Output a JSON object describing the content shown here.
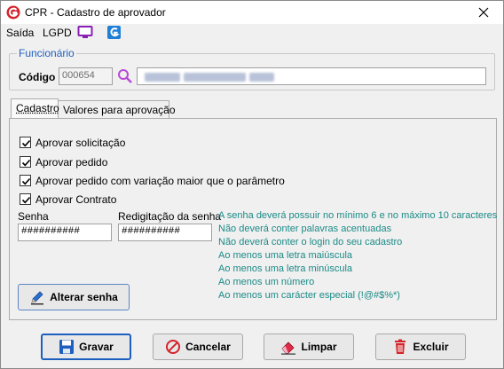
{
  "window": {
    "title": "CPR - Cadastro de aprovador"
  },
  "menu": {
    "items": [
      {
        "label": "Saída"
      },
      {
        "label": "LGPD"
      }
    ]
  },
  "funcionario": {
    "group_title": "Funcionário",
    "codigo_label": "Código",
    "codigo_value": "000654",
    "name_value_redacted": true
  },
  "tabs": [
    {
      "label": "Cadastro"
    },
    {
      "label": "Valores para aprovação"
    }
  ],
  "checkboxes": [
    {
      "label": "Aprovar solicitação",
      "checked": true
    },
    {
      "label": "Aprovar pedido",
      "checked": true
    },
    {
      "label": "Aprovar pedido com variação maior que o parâmetro",
      "checked": true
    },
    {
      "label": "Aprovar Contrato",
      "checked": true
    }
  ],
  "senha": {
    "label": "Senha",
    "value": "##########",
    "confirm_label": "Redigitação da senha",
    "confirm_value": "##########",
    "change_button": "Alterar senha"
  },
  "password_rules": [
    "A senha deverá possuir no mínimo 6 e no máximo 10 caracteres",
    "Não deverá conter palavras acentuadas",
    "Não deverá conter o login do seu cadastro",
    "Ao menos uma letra maiúscula",
    "Ao menos uma letra minúscula",
    "Ao menos um número",
    "Ao menos um carácter especial (!@#$%*)"
  ],
  "buttons": {
    "gravar": "Gravar",
    "cancelar": "Cancelar",
    "limpar": "Limpar",
    "excluir": "Excluir"
  },
  "colors": {
    "accent": "#1f5fbf",
    "rules_text": "#1a8a86",
    "lgpd_icon": "#8a1fb5",
    "search_icon": "#b84ad6"
  }
}
